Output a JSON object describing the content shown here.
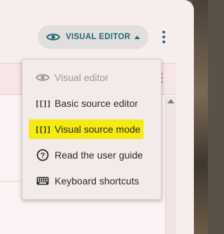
{
  "toolbar": {
    "editor_toggle_label": "VISUAL EDITOR",
    "accent_color": "#1e6b78"
  },
  "menu": {
    "items": [
      {
        "label": "Visual editor",
        "icon": "eye-icon",
        "disabled": true
      },
      {
        "label": "Basic source editor",
        "icon": "brackets-icon"
      },
      {
        "label": "Visual source mode",
        "icon": "brackets-icon",
        "highlighted": true
      },
      {
        "label": "Read the user guide",
        "icon": "question-icon"
      },
      {
        "label": "Keyboard shortcuts",
        "icon": "keyboard-icon"
      }
    ],
    "bracket_glyph": "[[]]",
    "question_glyph": "?",
    "highlight_color": "#f5ea12"
  }
}
